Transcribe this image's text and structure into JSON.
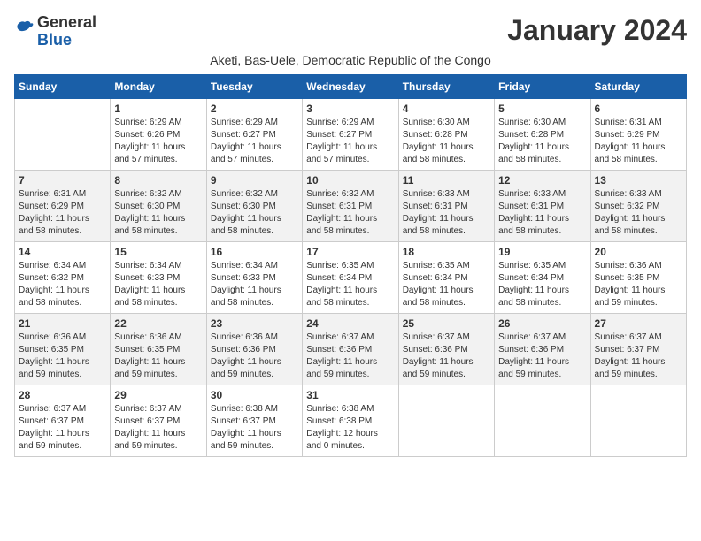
{
  "header": {
    "logo_general": "General",
    "logo_blue": "Blue",
    "month_title": "January 2024",
    "subtitle": "Aketi, Bas-Uele, Democratic Republic of the Congo"
  },
  "days_of_week": [
    "Sunday",
    "Monday",
    "Tuesday",
    "Wednesday",
    "Thursday",
    "Friday",
    "Saturday"
  ],
  "weeks": [
    [
      {
        "day": "",
        "info": ""
      },
      {
        "day": "1",
        "info": "Sunrise: 6:29 AM\nSunset: 6:26 PM\nDaylight: 11 hours\nand 57 minutes."
      },
      {
        "day": "2",
        "info": "Sunrise: 6:29 AM\nSunset: 6:27 PM\nDaylight: 11 hours\nand 57 minutes."
      },
      {
        "day": "3",
        "info": "Sunrise: 6:29 AM\nSunset: 6:27 PM\nDaylight: 11 hours\nand 57 minutes."
      },
      {
        "day": "4",
        "info": "Sunrise: 6:30 AM\nSunset: 6:28 PM\nDaylight: 11 hours\nand 58 minutes."
      },
      {
        "day": "5",
        "info": "Sunrise: 6:30 AM\nSunset: 6:28 PM\nDaylight: 11 hours\nand 58 minutes."
      },
      {
        "day": "6",
        "info": "Sunrise: 6:31 AM\nSunset: 6:29 PM\nDaylight: 11 hours\nand 58 minutes."
      }
    ],
    [
      {
        "day": "7",
        "info": "Sunrise: 6:31 AM\nSunset: 6:29 PM\nDaylight: 11 hours\nand 58 minutes."
      },
      {
        "day": "8",
        "info": "Sunrise: 6:32 AM\nSunset: 6:30 PM\nDaylight: 11 hours\nand 58 minutes."
      },
      {
        "day": "9",
        "info": "Sunrise: 6:32 AM\nSunset: 6:30 PM\nDaylight: 11 hours\nand 58 minutes."
      },
      {
        "day": "10",
        "info": "Sunrise: 6:32 AM\nSunset: 6:31 PM\nDaylight: 11 hours\nand 58 minutes."
      },
      {
        "day": "11",
        "info": "Sunrise: 6:33 AM\nSunset: 6:31 PM\nDaylight: 11 hours\nand 58 minutes."
      },
      {
        "day": "12",
        "info": "Sunrise: 6:33 AM\nSunset: 6:31 PM\nDaylight: 11 hours\nand 58 minutes."
      },
      {
        "day": "13",
        "info": "Sunrise: 6:33 AM\nSunset: 6:32 PM\nDaylight: 11 hours\nand 58 minutes."
      }
    ],
    [
      {
        "day": "14",
        "info": "Sunrise: 6:34 AM\nSunset: 6:32 PM\nDaylight: 11 hours\nand 58 minutes."
      },
      {
        "day": "15",
        "info": "Sunrise: 6:34 AM\nSunset: 6:33 PM\nDaylight: 11 hours\nand 58 minutes."
      },
      {
        "day": "16",
        "info": "Sunrise: 6:34 AM\nSunset: 6:33 PM\nDaylight: 11 hours\nand 58 minutes."
      },
      {
        "day": "17",
        "info": "Sunrise: 6:35 AM\nSunset: 6:34 PM\nDaylight: 11 hours\nand 58 minutes."
      },
      {
        "day": "18",
        "info": "Sunrise: 6:35 AM\nSunset: 6:34 PM\nDaylight: 11 hours\nand 58 minutes."
      },
      {
        "day": "19",
        "info": "Sunrise: 6:35 AM\nSunset: 6:34 PM\nDaylight: 11 hours\nand 58 minutes."
      },
      {
        "day": "20",
        "info": "Sunrise: 6:36 AM\nSunset: 6:35 PM\nDaylight: 11 hours\nand 59 minutes."
      }
    ],
    [
      {
        "day": "21",
        "info": "Sunrise: 6:36 AM\nSunset: 6:35 PM\nDaylight: 11 hours\nand 59 minutes."
      },
      {
        "day": "22",
        "info": "Sunrise: 6:36 AM\nSunset: 6:35 PM\nDaylight: 11 hours\nand 59 minutes."
      },
      {
        "day": "23",
        "info": "Sunrise: 6:36 AM\nSunset: 6:36 PM\nDaylight: 11 hours\nand 59 minutes."
      },
      {
        "day": "24",
        "info": "Sunrise: 6:37 AM\nSunset: 6:36 PM\nDaylight: 11 hours\nand 59 minutes."
      },
      {
        "day": "25",
        "info": "Sunrise: 6:37 AM\nSunset: 6:36 PM\nDaylight: 11 hours\nand 59 minutes."
      },
      {
        "day": "26",
        "info": "Sunrise: 6:37 AM\nSunset: 6:36 PM\nDaylight: 11 hours\nand 59 minutes."
      },
      {
        "day": "27",
        "info": "Sunrise: 6:37 AM\nSunset: 6:37 PM\nDaylight: 11 hours\nand 59 minutes."
      }
    ],
    [
      {
        "day": "28",
        "info": "Sunrise: 6:37 AM\nSunset: 6:37 PM\nDaylight: 11 hours\nand 59 minutes."
      },
      {
        "day": "29",
        "info": "Sunrise: 6:37 AM\nSunset: 6:37 PM\nDaylight: 11 hours\nand 59 minutes."
      },
      {
        "day": "30",
        "info": "Sunrise: 6:38 AM\nSunset: 6:37 PM\nDaylight: 11 hours\nand 59 minutes."
      },
      {
        "day": "31",
        "info": "Sunrise: 6:38 AM\nSunset: 6:38 PM\nDaylight: 12 hours\nand 0 minutes."
      },
      {
        "day": "",
        "info": ""
      },
      {
        "day": "",
        "info": ""
      },
      {
        "day": "",
        "info": ""
      }
    ]
  ]
}
